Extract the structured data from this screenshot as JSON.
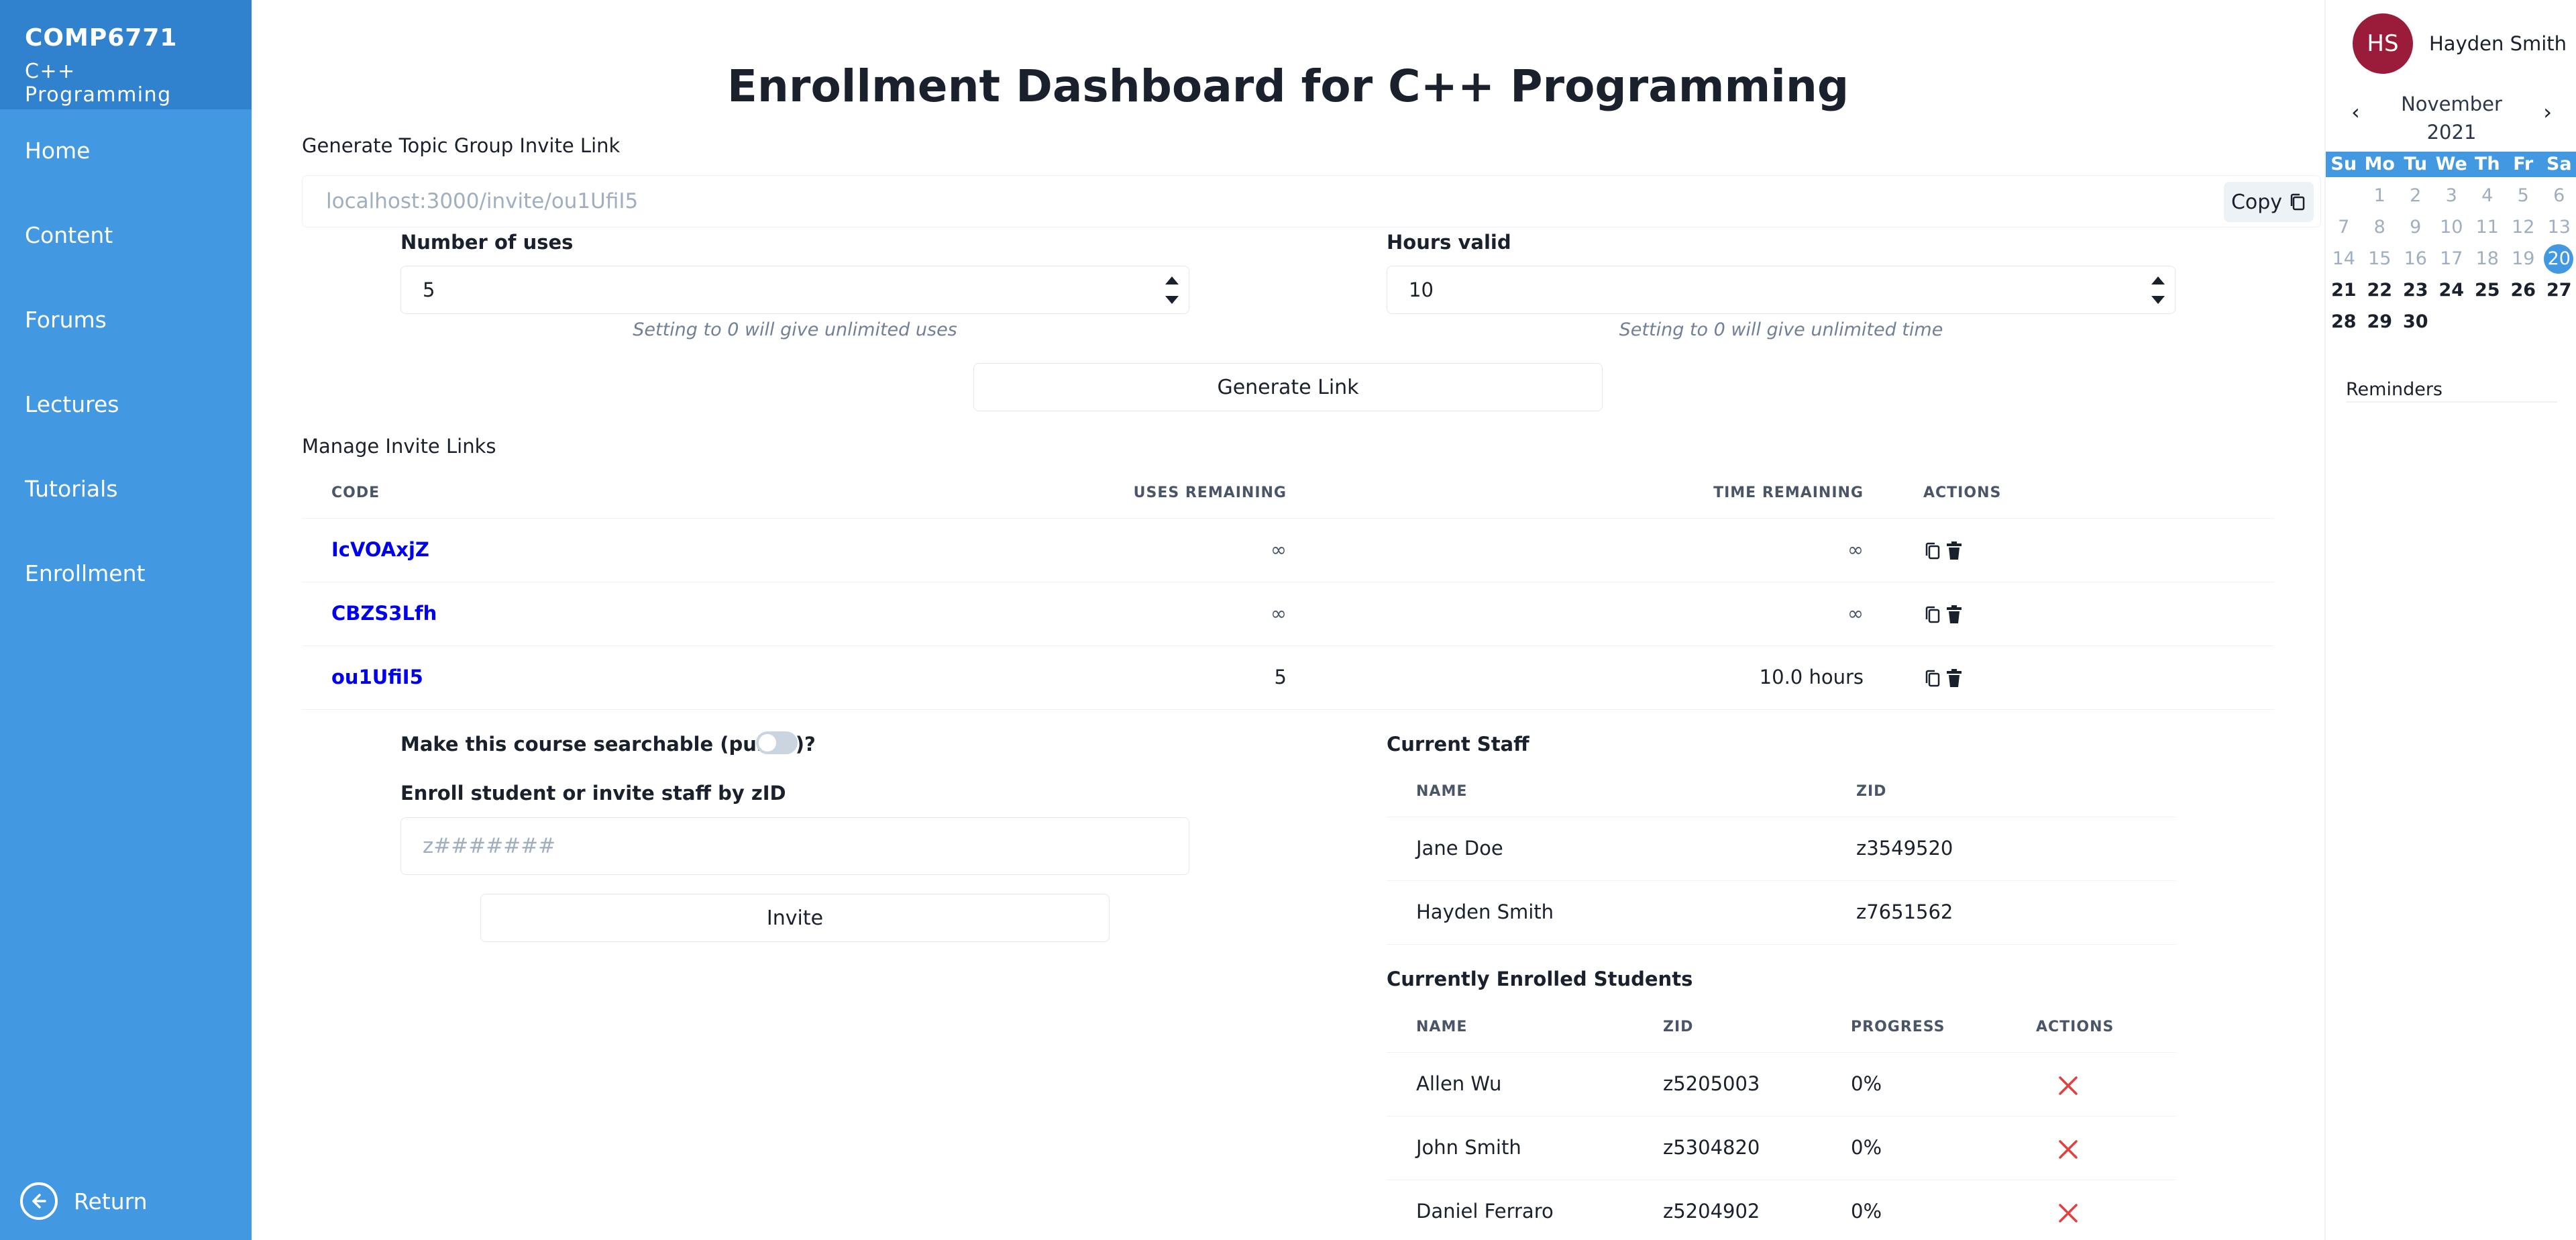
{
  "sidebar": {
    "course_code": "COMP6771",
    "course_name": "C++ Programming",
    "items": [
      {
        "label": "Home"
      },
      {
        "label": "Content"
      },
      {
        "label": "Forums"
      },
      {
        "label": "Lectures"
      },
      {
        "label": "Tutorials"
      },
      {
        "label": "Enrollment"
      }
    ],
    "return_label": "Return"
  },
  "main": {
    "title": "Enrollment Dashboard for C++ Programming",
    "invite": {
      "section_label": "Generate Topic Group Invite Link",
      "link_value": "localhost:3000/invite/ou1UfiI5",
      "copy_label": "Copy",
      "uses_label": "Number of uses",
      "uses_value": "5",
      "uses_helper": "Setting to 0 will give unlimited uses",
      "hours_label": "Hours valid",
      "hours_value": "10",
      "hours_helper": "Setting to 0 will give unlimited time",
      "generate_label": "Generate Link"
    },
    "manage": {
      "section_label": "Manage Invite Links",
      "headers": {
        "code": "Code",
        "uses": "Uses Remaining",
        "time": "Time Remaining",
        "actions": "Actions"
      },
      "rows": [
        {
          "code": "IcVOAxjZ",
          "uses": "∞",
          "time": "∞"
        },
        {
          "code": "CBZS3Lfh",
          "uses": "∞",
          "time": "∞"
        },
        {
          "code": "ou1UfiI5",
          "uses": "5",
          "time": "10.0 hours"
        }
      ]
    },
    "searchable_label": "Make this course searchable (public)?",
    "searchable_on": false,
    "enroll": {
      "label": "Enroll student or invite staff by zID",
      "placeholder": "z#######",
      "invite_label": "Invite"
    },
    "staff": {
      "title": "Current Staff",
      "headers": {
        "name": "Name",
        "zid": "zID"
      },
      "rows": [
        {
          "name": "Jane Doe",
          "zid": "z3549520"
        },
        {
          "name": "Hayden Smith",
          "zid": "z7651562"
        }
      ]
    },
    "students": {
      "title": "Currently Enrolled Students",
      "headers": {
        "name": "Name",
        "zid": "zID",
        "progress": "Progress",
        "actions": "Actions"
      },
      "rows": [
        {
          "name": "Allen Wu",
          "zid": "z5205003",
          "progress": "0%"
        },
        {
          "name": "John Smith",
          "zid": "z5304820",
          "progress": "0%"
        },
        {
          "name": "Daniel Ferraro",
          "zid": "z5204902",
          "progress": "0%"
        }
      ]
    }
  },
  "user": {
    "initials": "HS",
    "name": "Hayden Smith",
    "avatar_color": "#9b1c3a"
  },
  "calendar": {
    "month": "November",
    "year": "2021",
    "prev": "‹",
    "next": "›",
    "weekdays": [
      "Su",
      "Mo",
      "Tu",
      "We",
      "Th",
      "Fr",
      "Sa"
    ],
    "weeks": [
      [
        {
          "d": ""
        },
        {
          "d": "1"
        },
        {
          "d": "2"
        },
        {
          "d": "3"
        },
        {
          "d": "4"
        },
        {
          "d": "5"
        },
        {
          "d": "6"
        }
      ],
      [
        {
          "d": "7"
        },
        {
          "d": "8"
        },
        {
          "d": "9"
        },
        {
          "d": "10"
        },
        {
          "d": "11"
        },
        {
          "d": "12"
        },
        {
          "d": "13"
        }
      ],
      [
        {
          "d": "14"
        },
        {
          "d": "15"
        },
        {
          "d": "16"
        },
        {
          "d": "17"
        },
        {
          "d": "18"
        },
        {
          "d": "19"
        },
        {
          "d": "20",
          "today": true
        }
      ],
      [
        {
          "d": "21",
          "bold": true
        },
        {
          "d": "22",
          "bold": true
        },
        {
          "d": "23",
          "bold": true
        },
        {
          "d": "24",
          "bold": true
        },
        {
          "d": "25",
          "bold": true
        },
        {
          "d": "26",
          "bold": true
        },
        {
          "d": "27",
          "bold": true
        }
      ],
      [
        {
          "d": "28",
          "bold": true
        },
        {
          "d": "29",
          "bold": true
        },
        {
          "d": "30",
          "bold": true
        },
        {
          "d": ""
        },
        {
          "d": ""
        },
        {
          "d": ""
        },
        {
          "d": ""
        }
      ]
    ],
    "reminders_label": "Reminders"
  },
  "colors": {
    "sidebar": "#4299e1",
    "sidebar_header": "#3182ce",
    "link": "#0000ee",
    "remove": "#e53e3e",
    "today": "#4299e1"
  }
}
